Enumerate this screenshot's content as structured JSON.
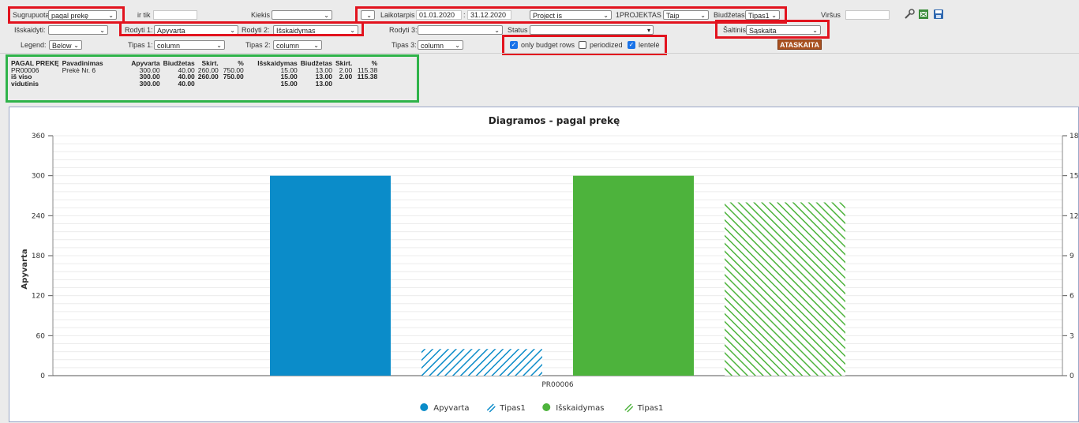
{
  "filters": {
    "row1": {
      "group_label": "Sugrupuota",
      "group_value": "pagal prekę",
      "only_label": "ir tik",
      "only_value": "",
      "kiekis_label": "Kiekis",
      "kiekis_value": "",
      "period_label": "Laikotarpis",
      "date_from": "01.01.2020",
      "date_to": "31.12.2020",
      "project_select": "Project is",
      "project_value": "1PROJEKTAS",
      "taip_value": "Taip",
      "budget_label": "Biudžetas",
      "budget_value": "Tipas1",
      "top_label": "Viršus",
      "top_value": ""
    },
    "row2": {
      "split_label": "Išskaidyti:",
      "split_value": "",
      "show1_label": "Rodyti 1:",
      "show1_value": "Apyvarta",
      "show2_label": "Rodyti 2:",
      "show2_value": "Išskaidymas",
      "show3_label": "Rodyti 3:",
      "show3_value": "",
      "status_label": "Status",
      "status_value": "",
      "source_label": "Šaltinis",
      "source_value": "Sąskaita"
    },
    "row3": {
      "legend_label": "Legend:",
      "legend_value": "Below",
      "type1_label": "Tipas 1:",
      "type1_value": "column",
      "type2_label": "Tipas 2:",
      "type2_value": "column",
      "type3_label": "Tipas 3:",
      "type3_value": "column",
      "only_budget_label": "only budget rows",
      "periodized_label": "periodized",
      "lentele_label": "lentelė",
      "report_button": "ATASKAITA"
    }
  },
  "summary_table": {
    "headers": [
      "PAGAL PREKĘ",
      "Pavadinimas",
      "Apyvarta",
      "Biudžetas",
      "Skirt.",
      "%",
      "Išskaidymas",
      "Biudžetas",
      "Skirt.",
      "%"
    ],
    "rows": [
      [
        "PR00006",
        "Prekė Nr. 6",
        "300.00",
        "40.00",
        "260.00",
        "750.00",
        "15.00",
        "13.00",
        "2.00",
        "115.38"
      ],
      [
        "iš viso",
        "",
        "300.00",
        "40.00",
        "260.00",
        "750.00",
        "15.00",
        "13.00",
        "2.00",
        "115.38"
      ],
      [
        "vidutinis",
        "",
        "300.00",
        "40.00",
        "",
        "",
        "15.00",
        "13.00",
        "",
        ""
      ]
    ]
  },
  "colors": {
    "apyvarta": "#0b8cc9",
    "tipas1_blue": "#0b8cc9",
    "isskaidymas": "#4db33c",
    "tipas1_green": "#4db33c",
    "highlight_red": "#e2131e",
    "highlight_green": "#2fb34a",
    "button": "#a8501f"
  },
  "chart_data": {
    "type": "bar",
    "title": "Diagramos - pagal prekę",
    "categories": [
      "PR00006"
    ],
    "ylabel": "Apyvarta",
    "ylim": [
      0,
      360
    ],
    "yticks": [
      0,
      60,
      120,
      180,
      240,
      300,
      360
    ],
    "y2lim": [
      0,
      18
    ],
    "y2ticks": [
      0,
      3,
      6,
      9,
      12,
      15,
      18
    ],
    "series": [
      {
        "name": "Apyvarta",
        "values": [
          300
        ],
        "axis": "left",
        "color": "#0b8cc9",
        "pattern": "solid"
      },
      {
        "name": "Tipas1",
        "values": [
          40
        ],
        "axis": "left",
        "color": "#0b8cc9",
        "pattern": "hatched"
      },
      {
        "name": "Išskaidymas",
        "values": [
          15
        ],
        "axis": "right",
        "color": "#4db33c",
        "pattern": "solid"
      },
      {
        "name": "Tipas1",
        "values": [
          13
        ],
        "axis": "right",
        "color": "#4db33c",
        "pattern": "hatched"
      }
    ],
    "legend_position": "bottom"
  }
}
